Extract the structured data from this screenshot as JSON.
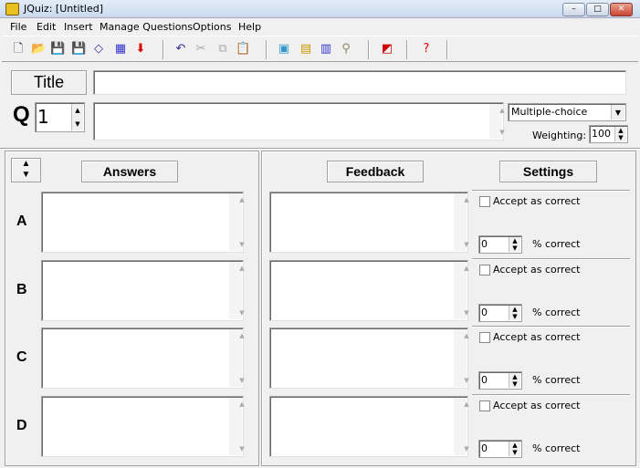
{
  "window": {
    "title": "JQuiz: [Untitled]",
    "minimize": "–",
    "maximize": "□",
    "close": "✕"
  },
  "menu": [
    "File",
    "Edit",
    "Insert",
    "Manage Questions",
    "Options",
    "Help"
  ],
  "toolbar": [
    {
      "icon": "new-file-icon",
      "glyph": "🗋",
      "color": "#333"
    },
    {
      "icon": "open-folder-icon",
      "glyph": "📂",
      "color": "#c90"
    },
    {
      "icon": "save-icon",
      "glyph": "💾",
      "color": "#000"
    },
    {
      "icon": "save-as-icon",
      "glyph": "💾",
      "color": "#226"
    },
    {
      "icon": "eraser-icon",
      "glyph": "◇",
      "color": "#339"
    },
    {
      "icon": "export-web-icon",
      "glyph": "▦",
      "color": "#33c"
    },
    {
      "icon": "arrow-down-icon",
      "glyph": "⬇",
      "color": "#d00"
    },
    {
      "icon": "undo-icon",
      "glyph": "↶",
      "color": "#339"
    },
    {
      "icon": "cut-icon",
      "glyph": "✂",
      "color": "#aaa"
    },
    {
      "icon": "copy-icon",
      "glyph": "⧉",
      "color": "#aaa"
    },
    {
      "icon": "paste-icon",
      "glyph": "📋",
      "color": "#335"
    },
    {
      "icon": "insert-picture-icon",
      "glyph": "▣",
      "color": "#39c"
    },
    {
      "icon": "insert-link-icon",
      "glyph": "▤",
      "color": "#c90"
    },
    {
      "icon": "insert-media-icon",
      "glyph": "▥",
      "color": "#33c"
    },
    {
      "icon": "insert-object-icon",
      "glyph": "⚲",
      "color": "#886"
    },
    {
      "icon": "config-icon",
      "glyph": "◩",
      "color": "#c00"
    },
    {
      "icon": "help-icon",
      "glyph": "?",
      "color": "#e00"
    }
  ],
  "title_label": "Title",
  "title_value": "",
  "question": {
    "label": "Q",
    "number": "1",
    "text": "",
    "type": "Multiple-choice",
    "weighting_label": "Weighting:",
    "weighting": "100"
  },
  "headers": {
    "answers": "Answers",
    "feedback": "Feedback",
    "settings": "Settings"
  },
  "rows": [
    {
      "letter": "A",
      "answer": "",
      "feedback": "",
      "accept_label": "Accept as correct",
      "accepted": false,
      "percent": "0",
      "percent_label": "% correct"
    },
    {
      "letter": "B",
      "answer": "",
      "feedback": "",
      "accept_label": "Accept as correct",
      "accepted": false,
      "percent": "0",
      "percent_label": "% correct"
    },
    {
      "letter": "C",
      "answer": "",
      "feedback": "",
      "accept_label": "Accept as correct",
      "accepted": false,
      "percent": "0",
      "percent_label": "% correct"
    },
    {
      "letter": "D",
      "answer": "",
      "feedback": "",
      "accept_label": "Accept as correct",
      "accepted": false,
      "percent": "0",
      "percent_label": "% correct"
    }
  ]
}
